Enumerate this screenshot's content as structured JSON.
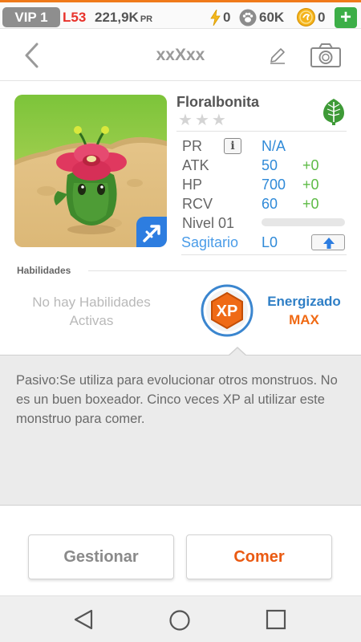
{
  "status_bar": {
    "vip": "VIP 1",
    "level": "L53",
    "power": "221,9K",
    "power_unit": "PR",
    "energy": "0",
    "pawprints": "60K",
    "coins": "0",
    "plus": "+"
  },
  "header": {
    "title": "xxXxx",
    "back_icon": "chevron-left-icon",
    "edit_icon": "pencil-icon",
    "camera_icon": "camera-icon"
  },
  "monster": {
    "name": "Floralbonita",
    "stars_total": 3,
    "stars_filled": 0,
    "element_icon": "leaf-icon",
    "sign_icon": "sagittarius-arrow-icon",
    "stats": [
      {
        "label": "PR",
        "value": "N/A",
        "bonus": ""
      },
      {
        "label": "ATK",
        "value": "50",
        "bonus": "+0"
      },
      {
        "label": "HP",
        "value": "700",
        "bonus": "+0"
      },
      {
        "label": "RCV",
        "value": "60",
        "bonus": "+0"
      }
    ],
    "level_label": "Nivel 01",
    "level_progress": 0,
    "sign_name": "Sagitario",
    "sign_level": "L0",
    "info_glyph": "i"
  },
  "abilities": {
    "title": "Habilidades",
    "empty_line1": "No hay Habilidades",
    "empty_line2": "Activas",
    "xp_label": "XP",
    "energized": "Energizado",
    "energized_level": "MAX"
  },
  "description": "Pasivo:Se utiliza para evolucionar otros monstruos. No es un buen boxeador. Cinco veces XP al utilizar este monstruo para comer.",
  "buttons": {
    "manage": "Gestionar",
    "eat": "Comer"
  },
  "colors": {
    "accent_orange": "#f06a14",
    "stat_blue": "#2f8ad8",
    "bonus_green": "#5dbb45",
    "level_red": "#e8322b"
  }
}
